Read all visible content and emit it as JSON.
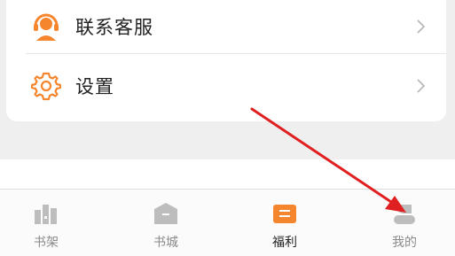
{
  "menu": {
    "items": [
      {
        "label": "联系客服",
        "icon": "customer-service-headset-icon"
      },
      {
        "label": "设置",
        "icon": "settings-gear-icon"
      }
    ]
  },
  "tabbar": {
    "tabs": [
      {
        "label": "书架",
        "icon": "bookshelf-icon",
        "active": false
      },
      {
        "label": "书城",
        "icon": "bookstore-icon",
        "active": false
      },
      {
        "label": "福利",
        "icon": "welfare-icon",
        "active": true
      },
      {
        "label": "我的",
        "icon": "profile-icon",
        "active": false
      }
    ]
  },
  "colors": {
    "accent": "#f5862e",
    "annotation_arrow": "#e02020",
    "inactive_icon": "#bdbdbd"
  }
}
